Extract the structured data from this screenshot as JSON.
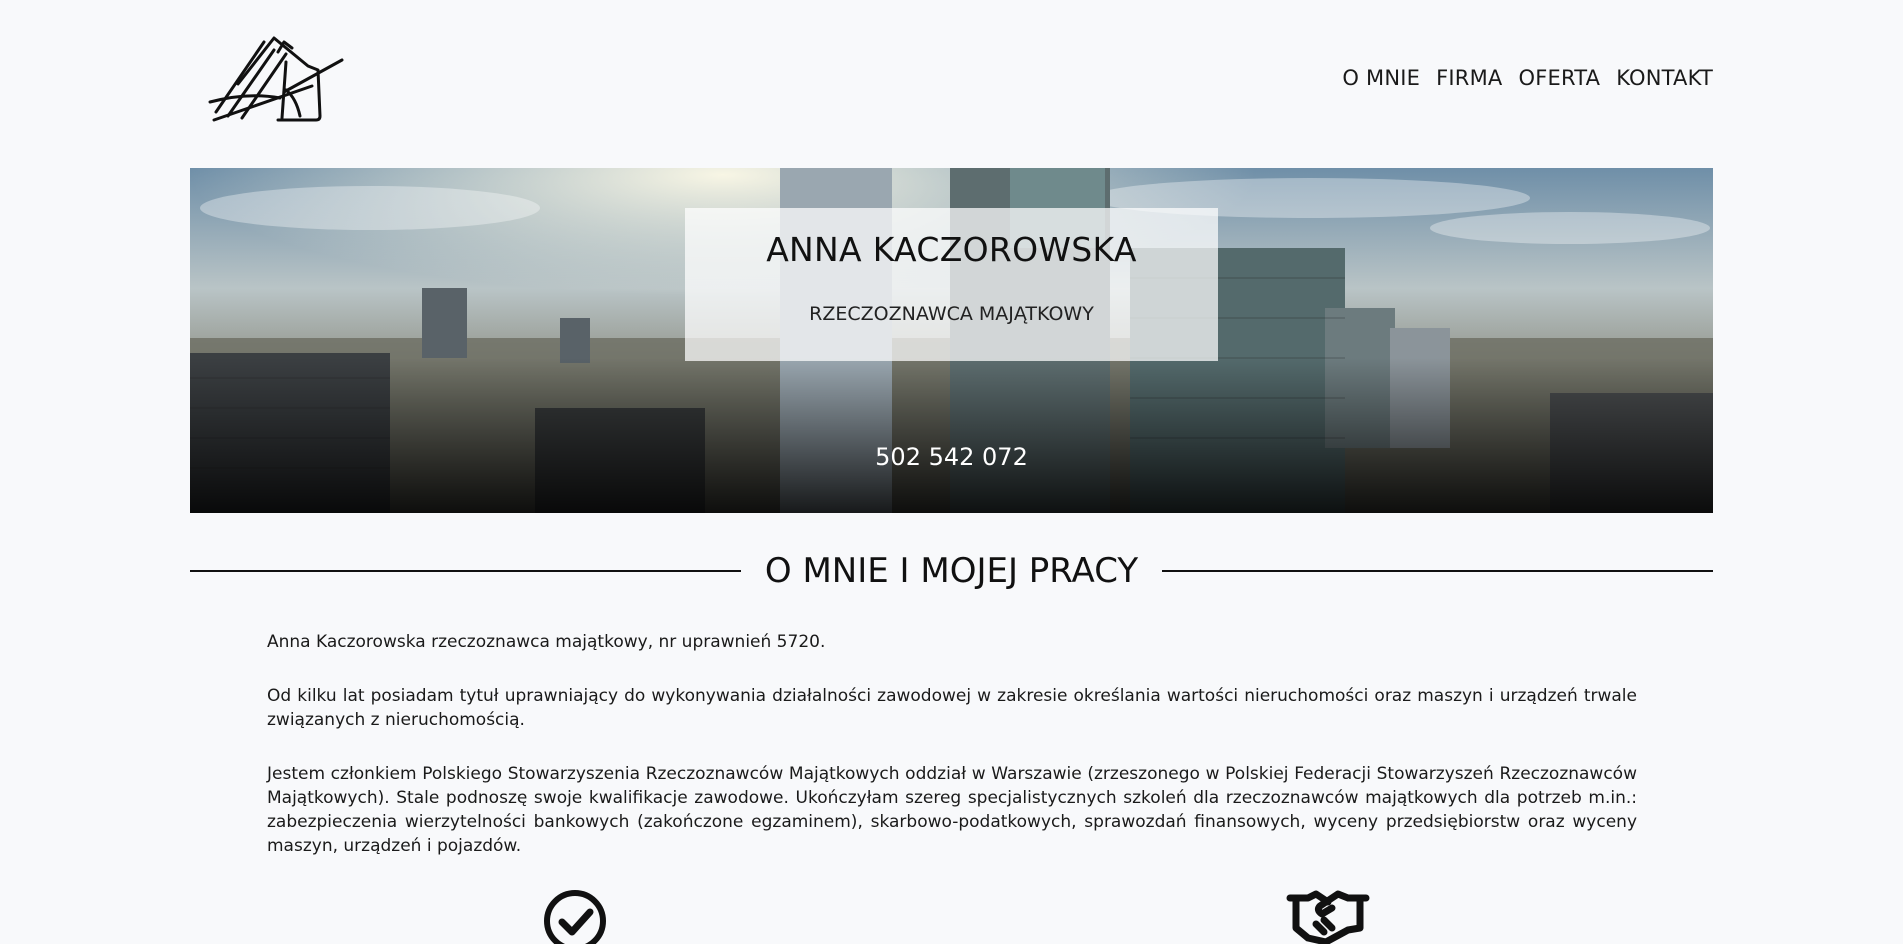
{
  "header": {
    "logo_alt": "AK",
    "nav": [
      {
        "label": "O MNIE"
      },
      {
        "label": "FIRMA"
      },
      {
        "label": "OFERTA"
      },
      {
        "label": "KONTAKT"
      }
    ]
  },
  "hero": {
    "name": "ANNA KACZOROWSKA",
    "role": "RZECZOZNAWCA MAJĄTKOWY",
    "phone": "502 542 072"
  },
  "about": {
    "heading": "O MNIE I MOJEJ PRACY",
    "paragraphs": [
      "Anna Kaczorowska rzeczoznawca majątkowy, nr uprawnień 5720.",
      "Od kilku lat posiadam tytuł uprawniający do wykonywania działalności zawodowej w zakresie określania wartości nieruchomości oraz maszyn i urządzeń trwale związanych z nieruchomością.",
      "Jestem członkiem Polskiego Stowarzyszenia Rzeczoznawców Majątkowych oddział w Warszawie (zrzeszonego w Polskiej Federacji Stowarzyszeń Rzeczoznawców Majątkowych). Stale podnoszę swoje kwalifikacje zawodowe. Ukończyłam szereg specjalistycznych szkoleń dla rzeczoznawców majątkowych dla potrzeb m.in.: zabezpieczenia wierzytelności bankowych (zakończone egzaminem), skarbowo-podatkowych, sprawozdań finansowych, wyceny przedsiębiorstw oraz wyceny maszyn, urządzeń i pojazdów."
    ]
  },
  "features": [
    {
      "icon": "check-circle-icon"
    },
    {
      "icon": "handshake-icon"
    }
  ]
}
